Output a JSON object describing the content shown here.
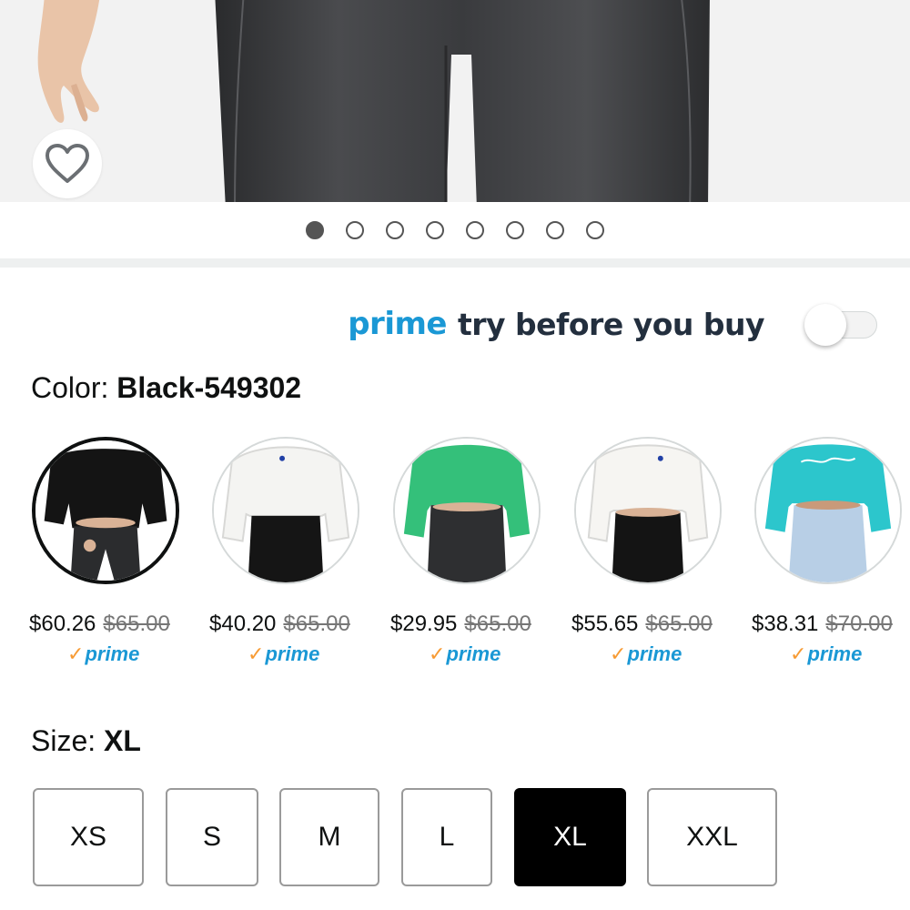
{
  "hero": {
    "image": "product-photo-jeans-black",
    "carousel_count": 8,
    "carousel_active_index": 0,
    "favorite_icon": "heart-outline-icon"
  },
  "prime_try": {
    "prime_label": "prime",
    "label": "try before you buy",
    "toggle_on": false
  },
  "color": {
    "label": "Color:",
    "selected": "Black-549302",
    "options": [
      {
        "image": "black-cropped-hoodie",
        "price": "$60.26",
        "list_price": "$65.00",
        "prime": "prime",
        "selected": true
      },
      {
        "image": "white-cropped-hoodie",
        "price": "$40.20",
        "list_price": "$65.00",
        "prime": "prime",
        "selected": false
      },
      {
        "image": "green-cropped-hoodie",
        "price": "$29.95",
        "list_price": "$65.00",
        "prime": "prime",
        "selected": false
      },
      {
        "image": "white-cropped-hoodie-2",
        "price": "$55.65",
        "list_price": "$65.00",
        "prime": "prime",
        "selected": false
      },
      {
        "image": "teal-cropped-hoodie",
        "price": "$38.31",
        "list_price": "$70.00",
        "prime": "prime",
        "selected": false
      }
    ]
  },
  "size": {
    "label": "Size:",
    "selected": "XL",
    "options": [
      "XS",
      "S",
      "M",
      "L",
      "XL",
      "XXL"
    ]
  },
  "colors": {
    "prime_blue": "#1a98d5",
    "prime_check": "#f79b34",
    "text_dark": "#0f1111",
    "strike_gray": "#767676"
  }
}
